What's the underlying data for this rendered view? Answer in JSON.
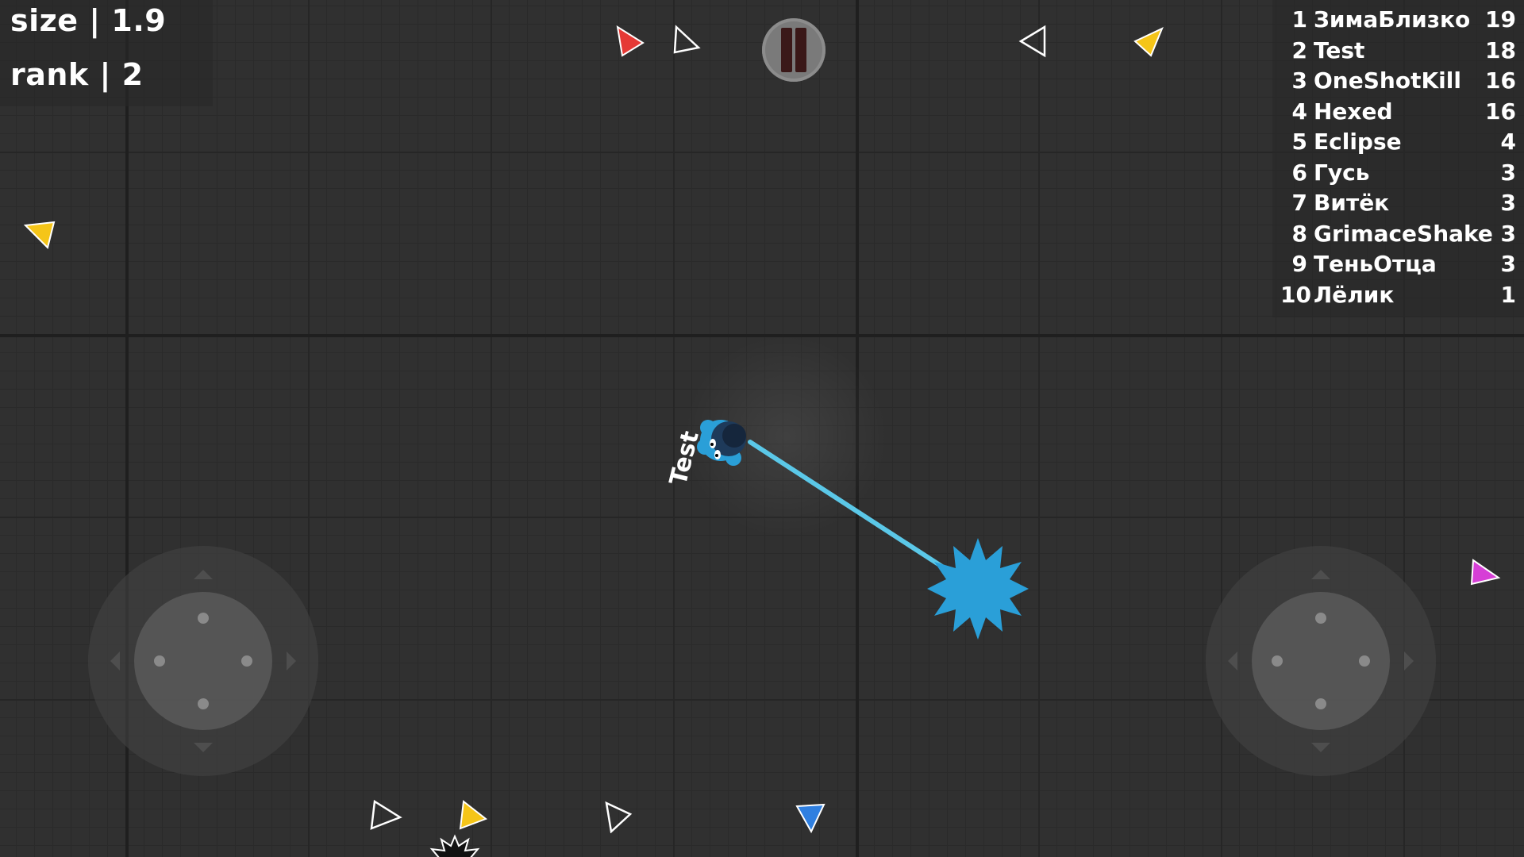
{
  "hud": {
    "size_label": "size",
    "size_value": "1.9",
    "rank_label": "rank",
    "rank_value": "2",
    "separator": "|"
  },
  "leaderboard": [
    {
      "rank": "1",
      "name": "ЗимаБлизко",
      "score": "19"
    },
    {
      "rank": "2",
      "name": "Test",
      "score": "18"
    },
    {
      "rank": "3",
      "name": "OneShotKill",
      "score": "16"
    },
    {
      "rank": "4",
      "name": "Hexed",
      "score": "16"
    },
    {
      "rank": "5",
      "name": "Eclipse",
      "score": "4"
    },
    {
      "rank": "6",
      "name": "Гусь",
      "score": "3"
    },
    {
      "rank": "7",
      "name": "Витёк",
      "score": "3"
    },
    {
      "rank": "8",
      "name": "GrimaceShake",
      "score": "3"
    },
    {
      "rank": "9",
      "name": "ТеньОтца",
      "score": "3"
    },
    {
      "rank": "10",
      "name": "Лёлик",
      "score": "1"
    }
  ],
  "player": {
    "name": "Test",
    "color": "#2a9fd8",
    "tether_color": "#5bc8e8"
  },
  "colors": {
    "background": "#303030",
    "pellet_red": "#e53935",
    "pellet_yellow": "#f5c518",
    "pellet_white": "#ffffff",
    "pellet_magenta": "#d63fd6",
    "pellet_blue": "#2f7fe0",
    "pause_button": "#7a7a7a"
  },
  "controls": {
    "pause_icon": "pause-icon",
    "left_joystick": "move-joystick",
    "right_joystick": "aim-joystick"
  }
}
